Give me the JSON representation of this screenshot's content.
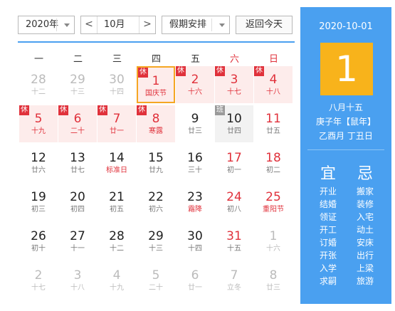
{
  "toolbar": {
    "year": "2020年",
    "prev": "<",
    "month": "10月",
    "next": ">",
    "holiday": "假期安排",
    "today": "返回今天"
  },
  "weekdays": [
    "一",
    "二",
    "三",
    "四",
    "五",
    "六",
    "日"
  ],
  "weeks": [
    [
      {
        "n": "28",
        "s": "十二",
        "dim": true
      },
      {
        "n": "29",
        "s": "十三",
        "dim": true
      },
      {
        "n": "30",
        "s": "十四",
        "dim": true
      },
      {
        "n": "1",
        "s": "国庆节",
        "hol": true,
        "tag": "休",
        "sel": true
      },
      {
        "n": "2",
        "s": "十六",
        "hol": true,
        "tag": "休"
      },
      {
        "n": "3",
        "s": "十七",
        "hol": true,
        "tag": "休"
      },
      {
        "n": "4",
        "s": "十八",
        "hol": true,
        "tag": "休"
      }
    ],
    [
      {
        "n": "5",
        "s": "十九",
        "hol": true,
        "tag": "休"
      },
      {
        "n": "6",
        "s": "二十",
        "hol": true,
        "tag": "休"
      },
      {
        "n": "7",
        "s": "廿一",
        "hol": true,
        "tag": "休"
      },
      {
        "n": "8",
        "s": "寒露",
        "hol": true,
        "tag": "休"
      },
      {
        "n": "9",
        "s": "廿三"
      },
      {
        "n": "10",
        "s": "廿四",
        "grey": true,
        "tag": "班"
      },
      {
        "n": "11",
        "s": "廿五",
        "we": true
      }
    ],
    [
      {
        "n": "12",
        "s": "廿六"
      },
      {
        "n": "13",
        "s": "廿七"
      },
      {
        "n": "14",
        "s": "标准日",
        "fest": true
      },
      {
        "n": "15",
        "s": "廿九"
      },
      {
        "n": "16",
        "s": "三十"
      },
      {
        "n": "17",
        "s": "初一",
        "we": true
      },
      {
        "n": "18",
        "s": "初二",
        "we": true
      }
    ],
    [
      {
        "n": "19",
        "s": "初三"
      },
      {
        "n": "20",
        "s": "初四"
      },
      {
        "n": "21",
        "s": "初五"
      },
      {
        "n": "22",
        "s": "初六"
      },
      {
        "n": "23",
        "s": "霜降",
        "fest": true
      },
      {
        "n": "24",
        "s": "初八",
        "we": true
      },
      {
        "n": "25",
        "s": "重阳节",
        "we": true,
        "fest": true
      }
    ],
    [
      {
        "n": "26",
        "s": "初十"
      },
      {
        "n": "27",
        "s": "十一"
      },
      {
        "n": "28",
        "s": "十二"
      },
      {
        "n": "29",
        "s": "十三"
      },
      {
        "n": "30",
        "s": "十四"
      },
      {
        "n": "31",
        "s": "十五",
        "we": true
      },
      {
        "n": "1",
        "s": "十六",
        "dim": true
      }
    ],
    [
      {
        "n": "2",
        "s": "十七",
        "dim": true
      },
      {
        "n": "3",
        "s": "十八",
        "dim": true
      },
      {
        "n": "4",
        "s": "十九",
        "dim": true
      },
      {
        "n": "5",
        "s": "二十",
        "dim": true
      },
      {
        "n": "6",
        "s": "廿一",
        "dim": true
      },
      {
        "n": "7",
        "s": "立冬",
        "dim": true
      },
      {
        "n": "8",
        "s": "廿三",
        "dim": true
      }
    ]
  ],
  "side": {
    "date": "2020-10-01",
    "big_day": "1",
    "lunar_day": "八月十五",
    "year_text": "庚子年【鼠年】",
    "month_day_text": "乙酉月 丁丑日",
    "yi_title": "宜",
    "ji_title": "忌",
    "yi": [
      "开业",
      "结婚",
      "领证",
      "开工",
      "订婚",
      "开张",
      "入学",
      "求嗣"
    ],
    "ji": [
      "搬家",
      "装修",
      "入宅",
      "动土",
      "安床",
      "出行",
      "上梁",
      "旅游"
    ]
  },
  "colors": {
    "accent": "#4aa0f0",
    "holiday_red": "#e0313b",
    "holiday_bg": "#fdeceb",
    "today_box": "#f8b31b"
  }
}
